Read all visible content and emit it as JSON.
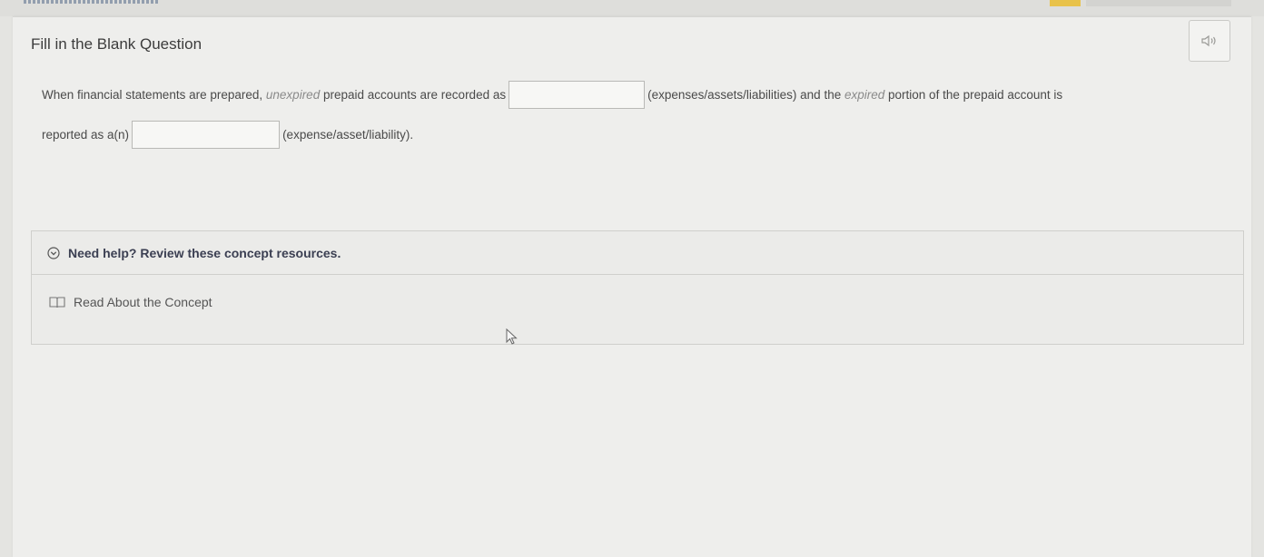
{
  "question": {
    "title": "Fill in the Blank Question",
    "line1_prefix": "When financial statements are prepared,",
    "line1_em1": "unexpired",
    "line1_mid": "prepaid accounts are recorded as",
    "blank1_value": "",
    "line1_after_blank": "(expenses/assets/liabilities) and the",
    "line1_em2": "expired",
    "line1_suffix": "portion of the prepaid account is",
    "line2_prefix": "reported as a(n)",
    "blank2_value": "",
    "line2_suffix": "(expense/asset/liability)."
  },
  "help": {
    "title": "Need help? Review these concept resources.",
    "link_label": "Read About the Concept"
  },
  "icons": {
    "audio": "speaker-icon",
    "expand": "chevron-circle-icon",
    "book": "book-icon",
    "cursor": "mouse-cursor-icon"
  },
  "colors": {
    "accent": "#e8c24a",
    "help_title": "#3b3f52"
  }
}
